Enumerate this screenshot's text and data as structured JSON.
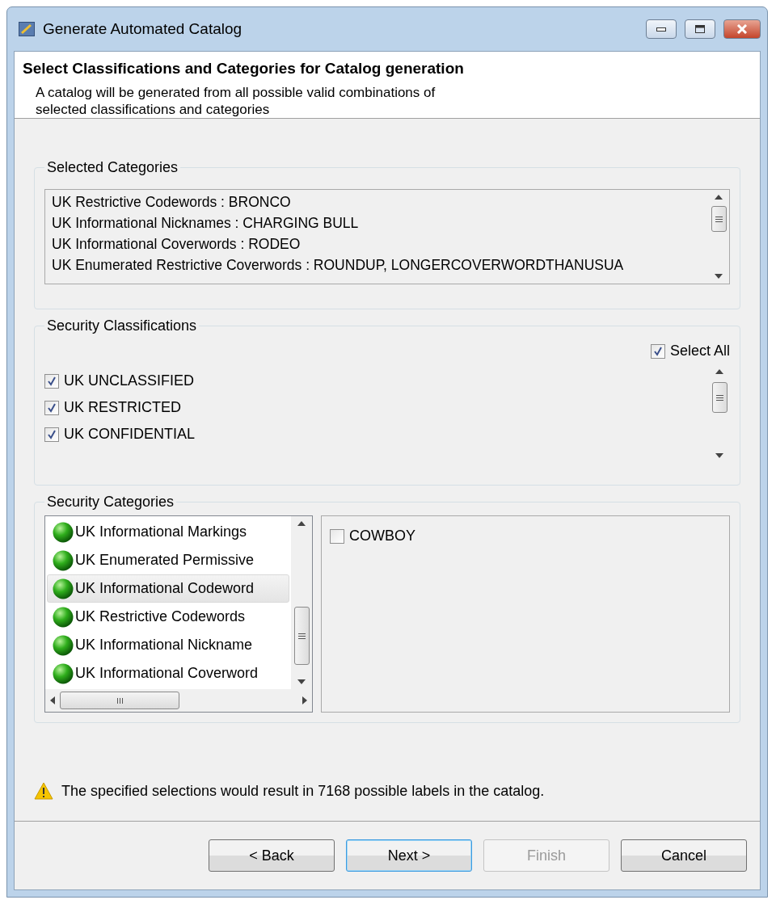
{
  "window": {
    "title": "Generate Automated Catalog"
  },
  "header": {
    "title": "Select Classifications and Categories for Catalog generation",
    "description": [
      "A catalog will be generated from all possible valid combinations of",
      "selected classifications and categories"
    ]
  },
  "selected_categories": {
    "legend": "Selected Categories",
    "lines": [
      "UK Restrictive Codewords : BRONCO",
      "UK Informational Nicknames : CHARGING BULL",
      "UK Informational Coverwords : RODEO",
      "UK Enumerated Restrictive Coverwords : ROUNDUP, LONGERCOVERWORDTHANUSUA"
    ]
  },
  "security_classifications": {
    "legend": "Security Classifications",
    "select_all": {
      "label": "Select All",
      "checked": true
    },
    "items": [
      {
        "label": "UK UNCLASSIFIED",
        "checked": true
      },
      {
        "label": "UK RESTRICTED",
        "checked": true
      },
      {
        "label": "UK CONFIDENTIAL",
        "checked": true
      }
    ]
  },
  "security_categories": {
    "legend": "Security Categories",
    "categories": [
      {
        "label": "UK Informational Markings",
        "selected": false
      },
      {
        "label": "UK Enumerated Permissive",
        "selected": false
      },
      {
        "label": "UK Informational Codeword",
        "selected": true
      },
      {
        "label": "UK Restrictive Codewords",
        "selected": false
      },
      {
        "label": "UK Informational Nickname",
        "selected": false
      },
      {
        "label": "UK Informational Coverword",
        "selected": false
      }
    ],
    "values": [
      {
        "label": "COWBOY",
        "checked": false
      }
    ]
  },
  "warning": "The specified selections would result in 7168 possible labels in the catalog.",
  "buttons": [
    {
      "label": "< Back",
      "disabled": false,
      "focused": false
    },
    {
      "label": "Next >",
      "disabled": false,
      "focused": true
    },
    {
      "label": "Finish",
      "disabled": true,
      "focused": false
    },
    {
      "label": "Cancel",
      "disabled": false,
      "focused": false
    }
  ]
}
